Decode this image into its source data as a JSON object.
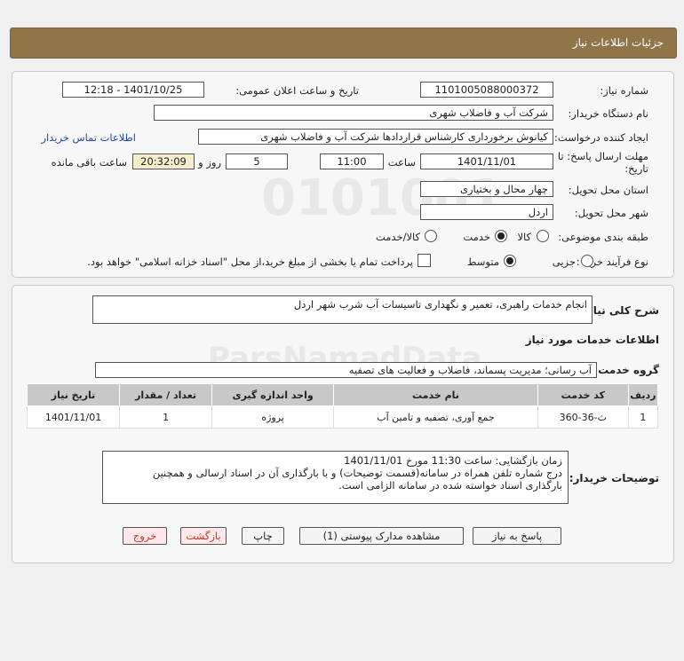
{
  "header": {
    "title": "جزئیات اطلاعات نیاز"
  },
  "form": {
    "need_number_label": "شماره نیاز:",
    "need_number": "1101005088000372",
    "announce_label": "تاریخ و ساعت اعلان عمومی:",
    "announce_value": "1401/10/25 - 12:18",
    "buyer_label": "نام دستگاه خریدار:",
    "buyer_value": "شرکت آب و فاضلاب شهری",
    "creator_label": "ایجاد کننده درخواست:",
    "creator_value": "کیانوش برخورداری کارشناس قراردادها شرکت آب و فاضلاب شهری",
    "contact_link": "اطلاعات تماس خریدار",
    "deadline_label_1": "مهلت ارسال پاسخ: تا",
    "deadline_label_2": "تاریخ:",
    "deadline_date": "1401/11/01",
    "time_label": "ساعت",
    "deadline_time": "11:00",
    "days_value": "5",
    "days_label": "روز و",
    "remaining_time": "20:32:09",
    "remaining_label": "ساعت باقی مانده",
    "province_label": "استان محل تحویل:",
    "province_value": "چهار محال و بختیاری",
    "city_label": "شهر محل تحویل:",
    "city_value": "اردل",
    "category_label": "طبقه بندی موضوعی:",
    "category_options": [
      "کالا",
      "خدمت",
      "کالا/خدمت"
    ],
    "category_selected": 1,
    "process_label": "نوع فرآیند خرید :",
    "process_options": [
      "جزیی",
      "متوسط"
    ],
    "process_selected": 1,
    "treasury_text": "پرداخت تمام یا بخشی از مبلغ خرید،از محل \"اسناد خزانه اسلامی\" خواهد بود."
  },
  "details": {
    "summary_label": "شرح کلی نیاز:",
    "summary_value": "انجام خدمات راهبری، تعمیر و نگهداری تاسیسات آب شرب شهر اردل",
    "services_title": "اطلاعات خدمات مورد نیاز",
    "group_label": "گروه خدمت:",
    "group_value": "آب رسانی؛ مدیریت پسماند، فاضلاب و فعالیت های تصفیه",
    "table": {
      "headers": [
        "ردیف",
        "کد خدمت",
        "نام خدمت",
        "واحد اندازه گیری",
        "تعداد / مقدار",
        "تاریخ نیاز"
      ],
      "rows": [
        [
          "1",
          "ث-36-360",
          "جمع آوری، تصفیه و تامین آب",
          "پروژه",
          "1",
          "1401/11/01"
        ]
      ]
    },
    "notes_label": "توضیحات خریدار:",
    "notes_line1": "زمان بازگشایی: ساعت 11:30 مورخ 1401/11/01",
    "notes_line2": "درج شماره تلفن همراه در سامانه(قسمت توضیحات) و با بارگذاری آن در اسناد ارسالی و همچنین",
    "notes_line3": "بارگذاری اسناد خواسته شده در سامانه الزامی است."
  },
  "buttons": {
    "reply": "پاسخ به نیاز",
    "view_docs": "مشاهده مدارک پیوستی (1)",
    "print": "چاپ",
    "back": "بازگشت",
    "exit": "خروج"
  }
}
